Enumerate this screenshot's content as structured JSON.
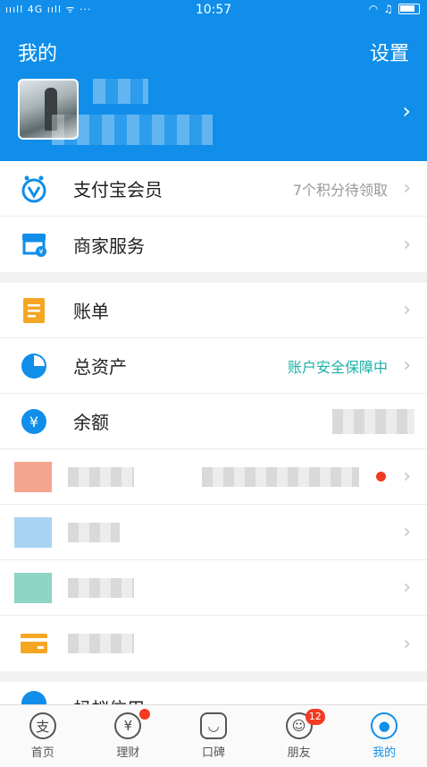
{
  "status_bar": {
    "signal": "ıııll 4G ııll ᯤ ···",
    "time": "10:57"
  },
  "header": {
    "title": "我的",
    "settings": "设置"
  },
  "group1": [
    {
      "label": "支付宝会员",
      "extra": "7个积分待领取",
      "icon": "member-icon",
      "color": "#108ee9"
    },
    {
      "label": "商家服务",
      "extra": "",
      "icon": "store-icon",
      "color": "#108ee9"
    }
  ],
  "group2": [
    {
      "label": "账单",
      "extra": "",
      "icon": "bill-icon",
      "color": "#f5a623"
    },
    {
      "label": "总资产",
      "extra": "账户安全保障中",
      "icon": "pie-chart-icon",
      "color": "#108ee9"
    },
    {
      "label": "余额",
      "extra": "",
      "icon": "yuan-icon",
      "color": "#108ee9"
    }
  ],
  "group3_partial": {
    "label": "蚂蚁信用"
  },
  "tabs": [
    {
      "label": "首页",
      "icon": "home-icon",
      "glyph": "支"
    },
    {
      "label": "理财",
      "icon": "wealth-icon",
      "glyph": "¥"
    },
    {
      "label": "口碑",
      "icon": "koubei-icon",
      "glyph": "◡"
    },
    {
      "label": "朋友",
      "icon": "friends-icon",
      "glyph": "☺",
      "badge": "12"
    },
    {
      "label": "我的",
      "icon": "me-icon",
      "glyph": "●"
    }
  ]
}
